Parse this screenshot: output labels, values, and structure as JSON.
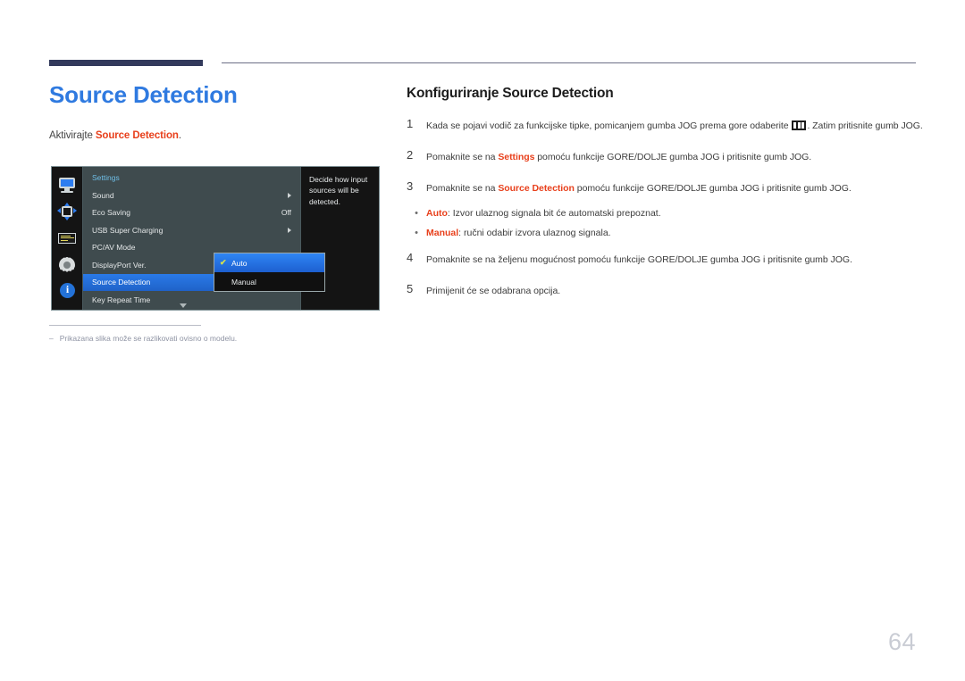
{
  "page": {
    "title": "Source Detection",
    "intro_prefix": "Aktivirajte ",
    "intro_highlight": "Source Detection",
    "intro_suffix": ".",
    "number": "64"
  },
  "osd": {
    "sidebar_icons": [
      "monitor-icon",
      "arrows-icon",
      "list-icon",
      "gear-icon",
      "info-icon"
    ],
    "menu_header": "Settings",
    "rows": [
      {
        "label": "Sound",
        "value": "",
        "arrow": true,
        "selected": false
      },
      {
        "label": "Eco Saving",
        "value": "Off",
        "arrow": false,
        "selected": false
      },
      {
        "label": "USB Super Charging",
        "value": "",
        "arrow": true,
        "selected": false
      },
      {
        "label": "PC/AV Mode",
        "value": "",
        "arrow": false,
        "selected": false
      },
      {
        "label": "DisplayPort Ver.",
        "value": "",
        "arrow": false,
        "selected": false
      },
      {
        "label": "Source Detection",
        "value": "",
        "arrow": false,
        "selected": true
      },
      {
        "label": "Key Repeat Time",
        "value": "",
        "arrow": false,
        "selected": false
      }
    ],
    "submenu": [
      {
        "label": "Auto",
        "checked": true
      },
      {
        "label": "Manual",
        "checked": false
      }
    ],
    "description": "Decide how input sources will be detected.",
    "colors": {
      "highlight": "#2a7ae8",
      "menu_bg": "#3f4b4e",
      "panel_bg": "#141414",
      "header_text": "#6fbfe8",
      "check": "#d9e24a"
    }
  },
  "footnote": {
    "dash": "‒",
    "text": "Prikazana slika može se razlikovati ovisno o modelu."
  },
  "instructions": {
    "section_title": "Konfiguriranje Source Detection",
    "steps": [
      {
        "num": "1",
        "pre": "Kada se pojavi vodič za funkcijske tipke, pomicanjem gumba JOG prema gore odaberite ",
        "glyph": "jog-menu-icon",
        "post": ". Zatim pritisnite gumb JOG."
      },
      {
        "num": "2",
        "pre": "Pomaknite se na ",
        "highlight": "Settings",
        "post": " pomoću funkcije GORE/DOLJE gumba JOG i pritisnite gumb JOG."
      },
      {
        "num": "3",
        "pre": "Pomaknite se na ",
        "highlight": "Source Detection",
        "post": " pomoću funkcije GORE/DOLJE gumba JOG i pritisnite gumb JOG."
      },
      {
        "num": "4",
        "pre": "Pomaknite se na željenu mogućnost pomoću funkcije GORE/DOLJE gumba JOG i pritisnite gumb JOG.",
        "highlight": "",
        "post": ""
      },
      {
        "num": "5",
        "pre": "Primijenit će se odabrana opcija.",
        "highlight": "",
        "post": ""
      }
    ],
    "bullets": [
      {
        "dot": "•",
        "highlight": "Auto",
        "text": ": Izvor ulaznog signala bit će automatski prepoznat."
      },
      {
        "dot": "•",
        "highlight": "Manual",
        "text": ": ručni odabir izvora ulaznog signala."
      }
    ]
  },
  "colors": {
    "title_blue": "#2f7ae0",
    "highlight_red": "#e8401c",
    "rule_navy": "#333a5c",
    "page_num_gray": "#c9ccd4"
  }
}
